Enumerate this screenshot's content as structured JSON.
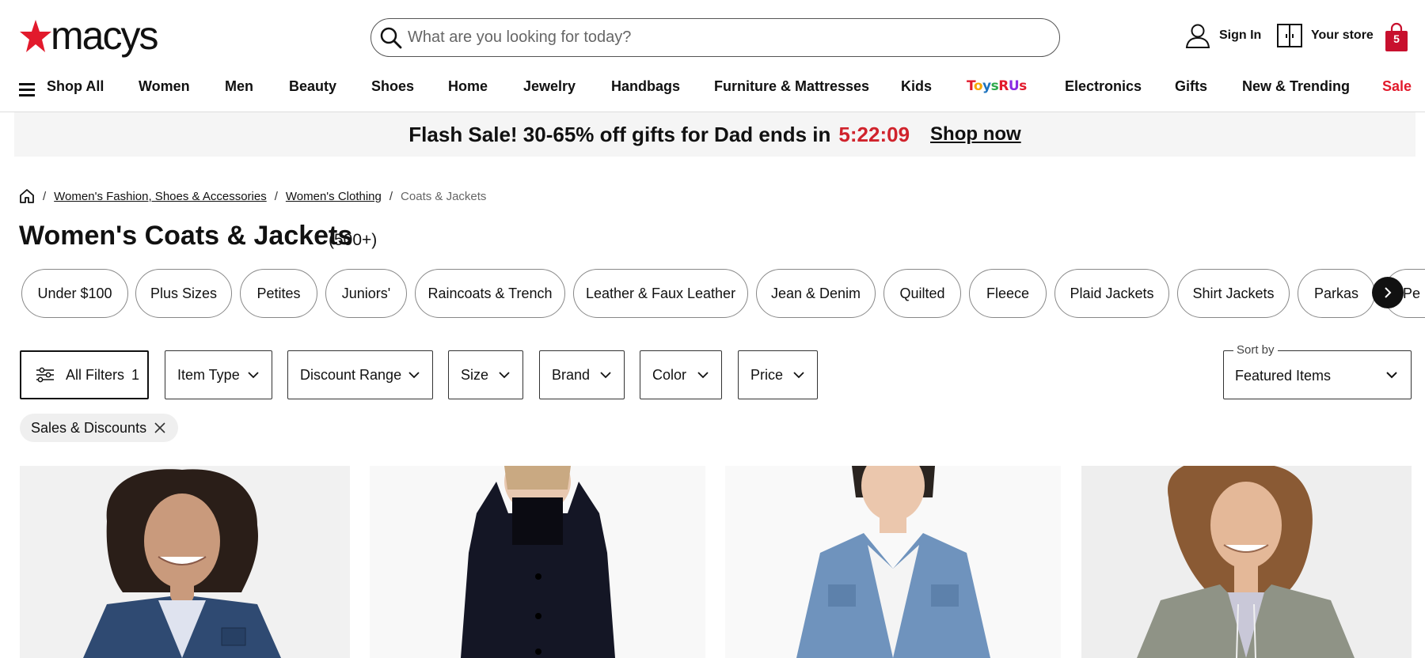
{
  "header": {
    "logo_text": "macys",
    "search_placeholder": "What are you looking for today?",
    "sign_in": "Sign In",
    "your_store": "Your store",
    "bag_count": "5"
  },
  "nav": {
    "shop_all": "Shop All",
    "items": [
      "Women",
      "Men",
      "Beauty",
      "Shoes",
      "Home",
      "Jewelry",
      "Handbags",
      "Furniture & Mattresses",
      "Kids",
      "Electronics",
      "Gifts",
      "New & Trending",
      "Sale"
    ],
    "toysrus_label": "ToysRUs",
    "toysrus_colors": [
      "#e21a2c",
      "#f7a600",
      "#1e73be",
      "#2ba84a",
      "#e21a2c",
      "#8a2be2"
    ]
  },
  "banner": {
    "text": "Flash Sale! 30-65% off gifts for Dad ends in",
    "timer": "5:22:09",
    "link": "Shop now"
  },
  "breadcrumb": {
    "items": [
      "Women's Fashion, Shoes & Accessories",
      "Women's Clothing"
    ],
    "current": "Coats & Jackets"
  },
  "page": {
    "title": "Women's Coats & Jackets",
    "count": "(500+)"
  },
  "chips": [
    "Under $100",
    "Plus Sizes",
    "Petites",
    "Juniors'",
    "Raincoats & Trench",
    "Leather & Faux Leather",
    "Jean & Denim",
    "Quilted",
    "Fleece",
    "Plaid Jackets",
    "Shirt Jackets",
    "Parkas",
    "Pe"
  ],
  "filters": {
    "all_filters": "All Filters",
    "all_filters_count": "1",
    "item_type": "Item Type",
    "discount_range": "Discount Range",
    "size": "Size",
    "brand": "Brand",
    "color": "Color",
    "price": "Price"
  },
  "sort": {
    "label": "Sort by",
    "value": "Featured Items"
  },
  "applied_filter": "Sales & Discounts",
  "colors": {
    "brand_red": "#e21a2c",
    "timer_red": "#d0232c",
    "bag_red": "#c8102e"
  }
}
